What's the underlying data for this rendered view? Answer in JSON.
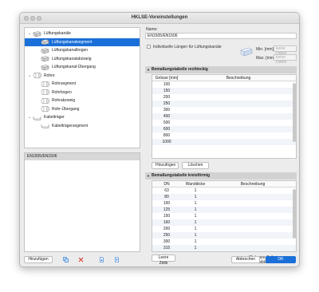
{
  "window": {
    "title": "HKLSE-Voreinstellungen"
  },
  "tree": [
    {
      "label": "Lüftungskanäle",
      "level": 0,
      "chevron": "⌄",
      "icon": "duct-group-icon",
      "selected": false
    },
    {
      "label": "Lüftungskanalsegment",
      "level": 1,
      "chevron": "",
      "icon": "duct-segment-icon",
      "selected": true
    },
    {
      "label": "Lüftungskanalbogen",
      "level": 1,
      "chevron": "",
      "icon": "duct-bend-icon",
      "selected": false
    },
    {
      "label": "Lüftungskanalabzweig",
      "level": 1,
      "chevron": "",
      "icon": "duct-branch-icon",
      "selected": false
    },
    {
      "label": "Lüftungskanal-Übergang",
      "level": 1,
      "chevron": "",
      "icon": "duct-transition-icon",
      "selected": false
    },
    {
      "label": "Rohre",
      "level": 0,
      "chevron": "⌄",
      "icon": "pipe-group-icon",
      "selected": false
    },
    {
      "label": "Rohrsegment",
      "level": 1,
      "chevron": "",
      "icon": "pipe-segment-icon",
      "selected": false
    },
    {
      "label": "Rohrbogen",
      "level": 1,
      "chevron": "",
      "icon": "pipe-bend-icon",
      "selected": false
    },
    {
      "label": "Rohrabzweig",
      "level": 1,
      "chevron": "",
      "icon": "pipe-branch-icon",
      "selected": false
    },
    {
      "label": "Rohr-Übergang",
      "level": 1,
      "chevron": "",
      "icon": "pipe-transition-icon",
      "selected": false
    },
    {
      "label": "Kabelträger",
      "level": 0,
      "chevron": "⌄",
      "icon": "cable-tray-group-icon",
      "selected": false
    },
    {
      "label": "Kabelträgersegment",
      "level": 1,
      "chevron": "",
      "icon": "cable-tray-segment-icon",
      "selected": false
    }
  ],
  "preset_list": {
    "items": [
      "EN1505/EN1506"
    ]
  },
  "left_toolbar": {
    "add_label": "Hinzufügen"
  },
  "name": {
    "label": "Name:",
    "value": "EN1505/EN1506"
  },
  "individual_lengths": {
    "label": "Individuelle Längen für Lüftungskanäle",
    "checked": false
  },
  "min": {
    "label": "Min. [mm]",
    "placeholder": "keine Daten"
  },
  "max": {
    "label": "Max. [mm]",
    "placeholder": "keine Daten"
  },
  "rect_table": {
    "title": "Bemaßungstabelle rechteckig",
    "headers": [
      "Grösse [mm]",
      "Beschreibung"
    ],
    "rows": [
      "100",
      "150",
      "200",
      "250",
      "300",
      "400",
      "500",
      "600",
      "800",
      "1000"
    ],
    "add_label": "Hinzufügen",
    "delete_label": "Löschen"
  },
  "round_table": {
    "title": "Bemaßungstabelle kreisförmig",
    "headers": [
      "DN",
      "Wanddicke",
      "Beschreibung"
    ],
    "rows": [
      {
        "dn": "63",
        "wall": "1"
      },
      {
        "dn": "80",
        "wall": "1"
      },
      {
        "dn": "100",
        "wall": "1"
      },
      {
        "dn": "125",
        "wall": "1"
      },
      {
        "dn": "150",
        "wall": "1"
      },
      {
        "dn": "160",
        "wall": "1"
      },
      {
        "dn": "200",
        "wall": "1"
      },
      {
        "dn": "250",
        "wall": "1"
      },
      {
        "dn": "300",
        "wall": "1"
      },
      {
        "dn": "315",
        "wall": "1"
      }
    ],
    "empty_row_label": "Leere Zeile",
    "hide_empty_label": "Leere Zeilen ausblenden"
  },
  "footer": {
    "cancel_label": "Abbrechen",
    "ok_label": "OK"
  },
  "colors": {
    "accent": "#1a6fd8",
    "delete_red": "#d9362b"
  }
}
